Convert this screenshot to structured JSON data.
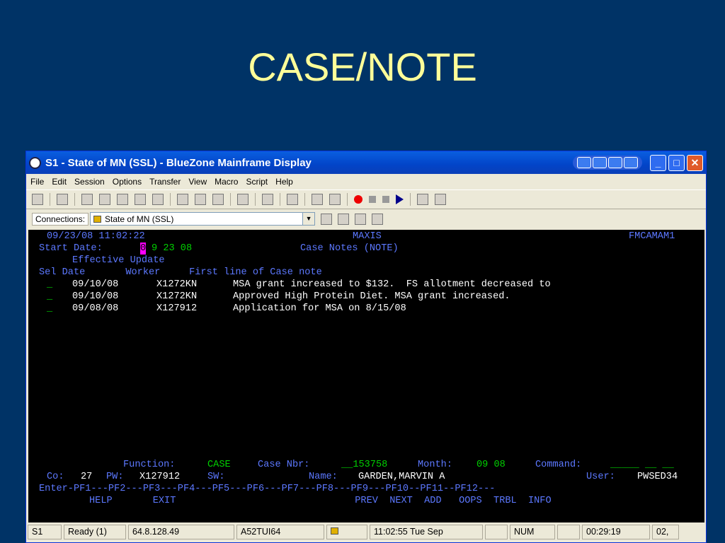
{
  "slide": {
    "title": "CASE/NOTE"
  },
  "window": {
    "title": "S1 - State of MN (SSL) - BlueZone Mainframe Display"
  },
  "menu": [
    "File",
    "Edit",
    "Session",
    "Options",
    "Transfer",
    "View",
    "Macro",
    "Script",
    "Help"
  ],
  "connections": {
    "label": "Connections:",
    "value": "State of MN (SSL)"
  },
  "terminal": {
    "datetime": "09/23/08 11:02:22",
    "system": "MAXIS",
    "screen_id": "FMCAMAM1",
    "start_label": "Start Date:",
    "start_cursor": "0",
    "start_rest": "9 23 08",
    "subtitle": "Case Notes (NOTE)",
    "hdr1": "Effective Update",
    "hdr2": "Sel Date       Worker     First line of Case note",
    "rows": [
      {
        "sel": "_",
        "date": "09/10/08",
        "worker": "X1272KN",
        "note": "MSA grant increased to $132.  FS allotment decreased to"
      },
      {
        "sel": "_",
        "date": "09/10/08",
        "worker": "X1272KN",
        "note": "Approved High Protein Diet. MSA grant increased."
      },
      {
        "sel": "_",
        "date": "09/08/08",
        "worker": "X127912",
        "note": "Application for MSA on 8/15/08"
      }
    ],
    "function_label": "Function:",
    "function_value": "CASE",
    "casenbr_label": "Case Nbr:",
    "casenbr_value": "__153758",
    "month_label": "Month:",
    "month_value": "09 08",
    "command_label": "Command:",
    "command_value": "_____ __ __",
    "co_label": "Co:",
    "co_value": "27",
    "pw_label": "PW:",
    "pw_value": "X127912",
    "sw_label": "SW:",
    "name_label": "Name:",
    "name_value": "GARDEN,MARVIN A",
    "user_label": "User:",
    "user_value": "PWSED34",
    "pfkeys": "Enter-PF1---PF2---PF3---PF4---PF5---PF6---PF7---PF8---PF9---PF10--PF11--PF12---",
    "pflabels": "HELP       EXIT                               PREV  NEXT  ADD   OOPS  TRBL  INFO"
  },
  "status": [
    "S1",
    "Ready (1)",
    "64.8.128.49",
    "A52TUI64",
    "",
    "11:02:55  Tue Sep",
    "",
    "NUM",
    "",
    "00:29:19",
    "02,"
  ]
}
